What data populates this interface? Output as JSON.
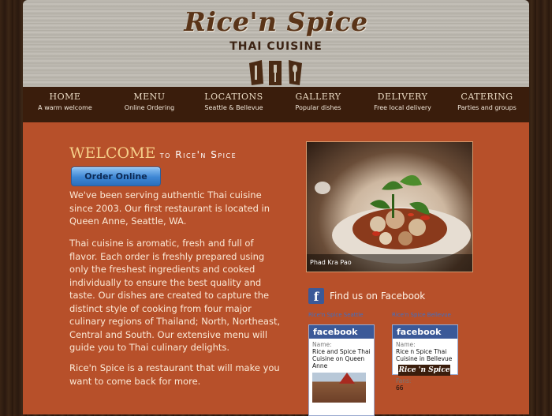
{
  "header": {
    "title": "Rice'n Spice",
    "subtitle": "THAI CUISINE"
  },
  "nav": [
    {
      "label": "HOME",
      "sub": "A warm welcome"
    },
    {
      "label": "MENU",
      "sub": "Online Ordering"
    },
    {
      "label": "LOCATIONS",
      "sub": "Seattle & Bellevue"
    },
    {
      "label": "GALLERY",
      "sub": "Popular dishes"
    },
    {
      "label": "DELIVERY",
      "sub": "Free local delivery"
    },
    {
      "label": "CATERING",
      "sub": "Parties and groups"
    }
  ],
  "welcome": {
    "big": "WELCOME",
    "small": " to Rice'n Spice"
  },
  "order_button": "Order Online",
  "paragraphs": [
    "We've been serving authentic Thai cuisine since 2003. Our first restaurant is located in Queen Anne, Seattle, WA.",
    "Thai cuisine is aromatic, fresh and full of flavor. Each order is freshly prepared using only the freshest ingredients and cooked individually to ensure the best quality and taste. Our dishes are created to capture the distinct style of cooking from four major culinary regions of Thailand; North, Northeast, Central and South. Our extensive menu will guide you to Thai culinary delights.",
    "Rice'n Spice is a restaurant that will make you want to come back for more."
  ],
  "photo_caption": "Phad Kra Pao",
  "facebook": {
    "icon_letter": "f",
    "find_text": "Find us on Facebook",
    "link_seattle": "Rice'n Spice Seattle",
    "link_bellevue": "Rice'n Spice Bellevue",
    "brand": "facebook",
    "name_label": "Name:",
    "fans_label": "Fans:",
    "seattle_name": "Rice and Spice Thai Cuisine on Queen Anne",
    "bellevue_name": "Rice n Spice Thai Cuisine in Bellevue",
    "bellevue_logo": "Rice 'n Spice",
    "bellevue_fans": "66"
  },
  "colors": {
    "content_bg": "#b7502a",
    "nav_bg": "#3a1d0c",
    "welcome_accent": "#f6d08a",
    "facebook_blue": "#3b5998"
  }
}
